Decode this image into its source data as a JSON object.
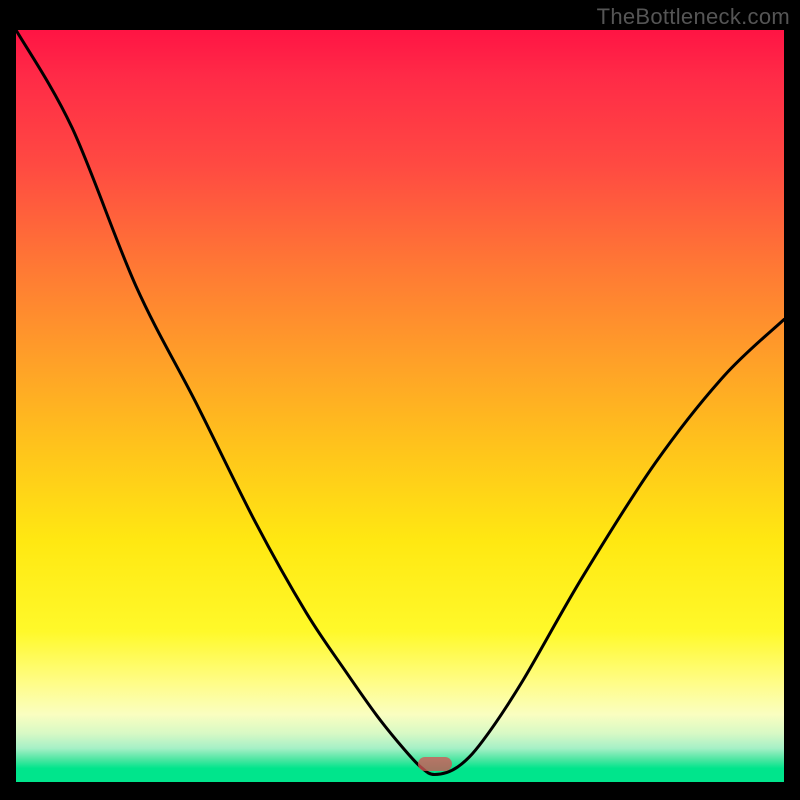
{
  "watermark": "TheBottleneck.com",
  "marker": {
    "x_frac": 0.545,
    "y_frac_from_top": 0.976
  },
  "chart_data": {
    "type": "line",
    "title": "",
    "xlabel": "",
    "ylabel": "",
    "xlim": [
      0,
      1
    ],
    "ylim": [
      0,
      1
    ],
    "series": [
      {
        "name": "bottleneck-curve",
        "x": [
          0.0,
          0.073,
          0.156,
          0.234,
          0.312,
          0.378,
          0.43,
          0.47,
          0.505,
          0.527,
          0.545,
          0.575,
          0.608,
          0.66,
          0.739,
          0.833,
          0.922,
          1.0
        ],
        "y": [
          1.0,
          0.87,
          0.66,
          0.505,
          0.345,
          0.225,
          0.146,
          0.088,
          0.044,
          0.02,
          0.01,
          0.02,
          0.055,
          0.135,
          0.275,
          0.425,
          0.54,
          0.615
        ],
        "_comment": "y = normalized distance from optimal (0 at notch, 1 at worst). x = normalized horizontal position."
      }
    ],
    "annotations": [
      {
        "type": "marker",
        "x": 0.545,
        "y": 0.01,
        "label": "optimal-point"
      }
    ]
  }
}
